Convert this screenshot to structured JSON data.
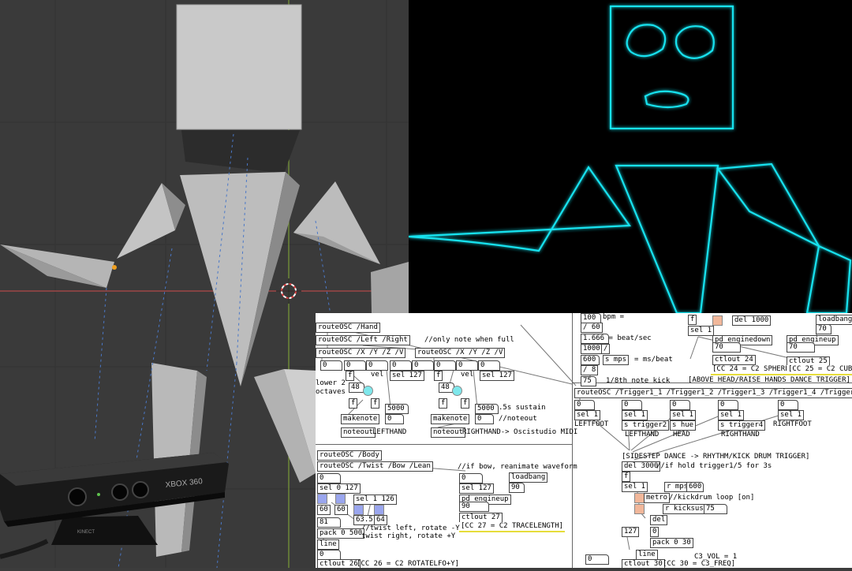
{
  "colors": {
    "viewport_bg": "#3a3a3a",
    "mesh_grey": "#bdbdbd",
    "osc_bg": "#000000",
    "osc_trace": "#19e3f0",
    "pd_bg": "#ffffff",
    "pd_highlight": "#e6dd3b",
    "toggle_blue": "#9aa6ee",
    "toggle_cyan": "#7fe8ec",
    "toggle_orange": "#f1b79a"
  },
  "kinect": {
    "brand": "XBOX 360",
    "sub": "KINECT"
  },
  "pd": {
    "hand": {
      "route_hand": "routeOSC /Hand",
      "route_lr": "routeOSC /Left /Right",
      "only_note": "//only note when full",
      "route_xyzv_l": "routeOSC /X /Y /Z /V",
      "route_xyzv_r": "routeOSC /X /Y /Z /V",
      "zeros": [
        "0",
        "0",
        "0",
        "0",
        "0",
        "0",
        "0",
        "0"
      ],
      "vel_l": "vel",
      "vel_r": "vel",
      "sel127_l": "sel 127",
      "sel127_r": "sel 127",
      "lower": "lower 2",
      "octaves": "octaves",
      "n48_l": "48",
      "n48_r": "48",
      "f_l1": "f",
      "f_l2": "f",
      "f_l3": "f",
      "f_r1": "f",
      "f_r2": "f",
      "f_r3": "f",
      "n5000_l": "5000",
      "n5000_r": "5000",
      "sustain": ".5s sustain",
      "makenote_l": "makenote",
      "makenote_r": "makenote",
      "zero_l": "0",
      "zero_r": "0",
      "noteout_cmt": "//noteout",
      "noteout_l": "noteout",
      "noteout_r": "noteout",
      "lefthand": "LEFTHAND",
      "righthand": "RIGHTHAND-> Oscistudio MIDI"
    },
    "tempo": {
      "bpm_val": "100",
      "bpm_lbl": "bpm =",
      "div60": "/ 60",
      "beatsec": "1.666 = beat/sec",
      "n1000": "1000",
      "slash": "/",
      "n600": "600",
      "smps": "s mps",
      "msbeat": "= ms/beat",
      "div8": "/ 8",
      "n75": "75",
      "kick_lbl": "1/8th note kick"
    },
    "head": {
      "f": "f",
      "del1000": "del 1000",
      "loadbang": "loadbang",
      "n70a": "70",
      "sel1": "sel 1",
      "pd_down": "pd enginedown",
      "pd_up": "pd engineup",
      "n70b": "70",
      "n70c": "70",
      "ctlout24": "ctlout 24",
      "ctlout25": "ctlout 25",
      "cc24": "[CC 24 = C2 SPHERE]",
      "cc25": "[CC 25 = C2 CUBE]",
      "above_head": "[ABOVE HEAD/RAISE HANDS DANCE TRIGGER]"
    },
    "trigger": {
      "route": "routeOSC /Trigger1_1 /Trigger1_2 /Trigger1_3 /Trigger1_4 /Trigger1_5",
      "zeros": [
        "0",
        "0",
        "0",
        "0",
        "0"
      ],
      "sel1s": [
        "sel 1",
        "sel 1",
        "sel 1",
        "sel 1",
        "sel 1"
      ],
      "s_trigger2": "s trigger2",
      "s_hue": "s hue",
      "s_trigger4": "s trigger4",
      "leftfoot": "LEFTFOOT",
      "lefthand": "LEFTHAND",
      "head": "HEAD",
      "righthand": "RIGHTHAND",
      "rightfoot": "RIGHTFOOT",
      "sidestep": "[SIDESTEP DANCE -> RHYTHM/KICK DRUM TRIGGER]",
      "del3000": "del 3000",
      "hold_cmt": "//if hold trigger1/5 for 3s",
      "f": "f",
      "r_mps": "r mps",
      "n600": "600",
      "sel1": "sel 1",
      "metro": "metro",
      "kick_loop": "//kickdrum loop [on]",
      "del": "del",
      "r_kicksust": "r kicksust",
      "n75": "75",
      "n127": "127",
      "zero": "0",
      "pack": "pack 0 30",
      "line": "line",
      "zero_b": "0",
      "ctlout30": "ctlout 30",
      "cc30": "[CC 30 = C3_FREQ]",
      "c3vol": "C3_VOL = 1"
    },
    "body": {
      "route_body": "routeOSC /Body",
      "route_tbl": "routeOSC /Twist /Bow /Lean",
      "bow_cmt": "//if bow, reanimate waveform",
      "zero_a": "0",
      "zero_b": "0",
      "loadbang": "loadbang",
      "sel0127": "sel 0 127",
      "sel127": "sel 127",
      "n90a": "90",
      "sel1126": "sel 1 126",
      "pd_up": "pd engineup",
      "n90b": "90",
      "n60a": "60",
      "n60b": "60",
      "n635": "63.5",
      "n64": "64",
      "n81": "81",
      "ctlout27": "ctlout 27",
      "cc27": "[CC 27 = C2 TRACELENGTH]",
      "twist_l": "//twist left, rotate -Y",
      "twist_r": "twist right, rotate +Y",
      "pack": "pack 0 500",
      "line": "line",
      "zero_c": "0",
      "ctlout26": "ctlout 26",
      "cc26": "[CC 26 = C2 ROTATELFO+Y]"
    }
  }
}
